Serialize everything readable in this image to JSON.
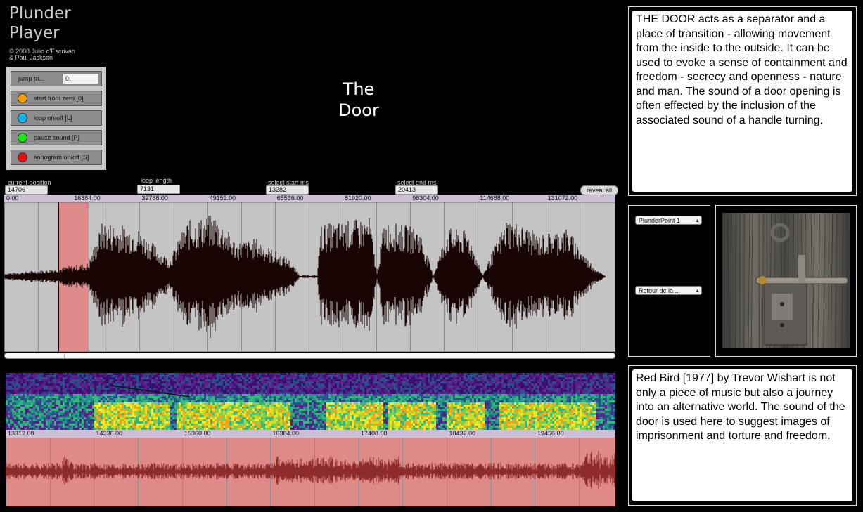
{
  "app": {
    "title_line1": "Plunder",
    "title_line2": "Player",
    "copyright_line1": "© 2008 Julio d'Escriván",
    "copyright_line2": "& Paul Jackson"
  },
  "controls": {
    "jump_label": "jump to...",
    "jump_value": "0.",
    "start_label": "start from zero [0]",
    "loop_label": "loop on/off [L]",
    "pause_label": "pause sound [P]",
    "sonogram_label": "sonogram on/off [S]",
    "colors": {
      "start": "#f5a000",
      "loop": "#11b6f0",
      "pause": "#18e818",
      "sonogram": "#ee1111"
    }
  },
  "sound_title_line1": "The",
  "sound_title_line2": "Door",
  "fields": {
    "current_position_label": "current position",
    "current_position": "14706",
    "loop_length_label": "loop length",
    "loop_length": "7131",
    "select_start_label": "select start ms",
    "select_start": "13282",
    "select_end_label": "select end ms",
    "select_end": "20413",
    "reveal_all": "reveal all"
  },
  "main_ruler": [
    "0.00",
    "16384.00",
    "32768.00",
    "49152.00",
    "65536.00",
    "81920.00",
    "98304.00",
    "114688.00",
    "131072.00"
  ],
  "zoom_ruler": [
    "13312.00",
    "14336.00",
    "15360.00",
    "16384.00",
    "17408.00",
    "18432.00",
    "19456.00"
  ],
  "description_top": "THE DOOR acts as a separator and a place of transition - allowing movement from the inside to the outside. It can be used to evoke a sense of containment and freedom - secrecy and openness - nature and man. The sound of a door opening is often effected by the inclusion of the associated sound of a handle turning.",
  "description_bottom": "Red Bird [1977] by Trevor Wishart is not only a piece of music but also a journey into an alternative world. The sound of the door is used here to suggest images of imprisonment and torture and freedom.",
  "selectors": {
    "plunder_point": "PlunderPoint 1",
    "track": "Retour de la ..."
  },
  "colors": {
    "waveform": "#1a0505",
    "selection": "#df8a88",
    "zoom_wave": "#8e2b2b",
    "ruler": "#cdbfd6"
  }
}
